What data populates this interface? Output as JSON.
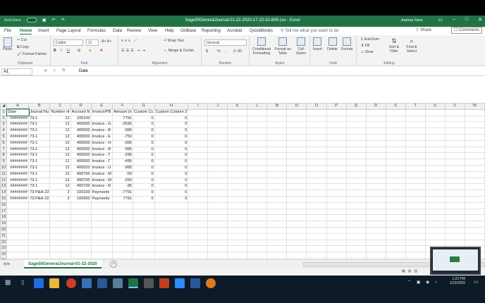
{
  "titlebar": {
    "autosave": "AutoSave",
    "autosave_state": "Off",
    "title": "Sage50GeneralJournal-01-22-2020-17-22-32-605.csv  -  Excel",
    "user": "Joanna Gore"
  },
  "menu": {
    "tabs": [
      "File",
      "Home",
      "Insert",
      "Page Layout",
      "Formulas",
      "Data",
      "Review",
      "View",
      "Help",
      "OnBase",
      "Reporting",
      "Acrobat",
      "QuickBooks"
    ],
    "tell_me": "Tell me what you want to do",
    "share": "Share",
    "comments": "Comments"
  },
  "ribbon": {
    "clipboard": {
      "label": "Clipboard",
      "paste": "Paste",
      "cut": "Cut",
      "copy": "Copy",
      "format_painter": "Format Painter"
    },
    "font": {
      "label": "Font",
      "name": "Calibri",
      "size": "11",
      "bold": "B",
      "italic": "I",
      "underline": "U"
    },
    "alignment": {
      "label": "Alignment",
      "wrap": "Wrap Text",
      "merge": "Merge & Center"
    },
    "number": {
      "label": "Number",
      "format": "General",
      "currency": "$",
      "percent": "%",
      "comma": ","
    },
    "styles": {
      "label": "Styles",
      "conditional": "Conditional Formatting",
      "format_table": "Format as Table",
      "cell_styles": "Cell Styles"
    },
    "cells": {
      "label": "Cells",
      "insert": "Insert",
      "delete": "Delete",
      "format": "Format"
    },
    "editing": {
      "label": "Editing",
      "autosum": "AutoSum",
      "fill": "Fill",
      "clear": "Clear",
      "sort": "Sort & Filter",
      "find": "Find & Select"
    }
  },
  "formula_bar": {
    "name_box": "A1",
    "content": "Date",
    "cancel": "✕",
    "enter": "✓",
    "fx": "fx"
  },
  "grid": {
    "columns": [
      "A",
      "B",
      "C",
      "D",
      "E",
      "F",
      "G",
      "H",
      "I",
      "J",
      "K",
      "L",
      "M",
      "N",
      "O",
      "P",
      "Q",
      "R",
      "S",
      "T",
      "U",
      "V",
      "W"
    ],
    "rows": [
      [
        "Date",
        "Journal Nu",
        "Number of",
        "Account N",
        "Invoice/PB",
        "Amount (n",
        "Custom Cc",
        "Custom Column 2"
      ],
      [
        "########",
        "73-1",
        "12",
        "100100",
        "",
        "7791",
        "0",
        "0"
      ],
      [
        "########",
        "73-1",
        "12",
        "400000",
        "Invoice - G",
        "-2536",
        "0",
        "0"
      ],
      [
        "########",
        "73-1",
        "12",
        "400500",
        "Invoice - B",
        "-995",
        "0",
        "0"
      ],
      [
        "########",
        "73-1",
        "12",
        "400500",
        "Invoice - E",
        "-750",
        "0",
        "0"
      ],
      [
        "########",
        "73-1",
        "12",
        "400500",
        "Invoice - H",
        "-395",
        "0",
        "0"
      ],
      [
        "########",
        "73-1",
        "12",
        "400500",
        "Invoice - R",
        "-995",
        "0",
        "0"
      ],
      [
        "########",
        "73-1",
        "12",
        "400500",
        "Invoice - T",
        "-295",
        "0",
        "0"
      ],
      [
        "########",
        "73-1",
        "12",
        "400500",
        "Invoice - T",
        "-495",
        "0",
        "0"
      ],
      [
        "########",
        "73-1",
        "12",
        "400520",
        "Invoice - U",
        "-995",
        "0",
        "0"
      ],
      [
        "########",
        "73-1",
        "12",
        "400700",
        "Invoice - M",
        "-50",
        "0",
        "0"
      ],
      [
        "########",
        "73-1",
        "12",
        "400700",
        "Invoice - M",
        "-250",
        "0",
        "0"
      ],
      [
        "########",
        "73-1",
        "12",
        "400700",
        "Invoice - R",
        "-35",
        "0",
        "0"
      ],
      [
        "########",
        "73-P&A-22",
        "2",
        "100100",
        "Payments",
        "-7791",
        "0",
        "0"
      ],
      [
        "########",
        "73-P&A-22",
        "2",
        "100300",
        "Payments",
        "7791",
        "0",
        "0"
      ]
    ],
    "total_rows": 26
  },
  "sheet_tab": "Sage50GeneralJournal-01-22-2020",
  "taskbar": {
    "time": "1:22 PM",
    "date": "1/22/2020"
  }
}
